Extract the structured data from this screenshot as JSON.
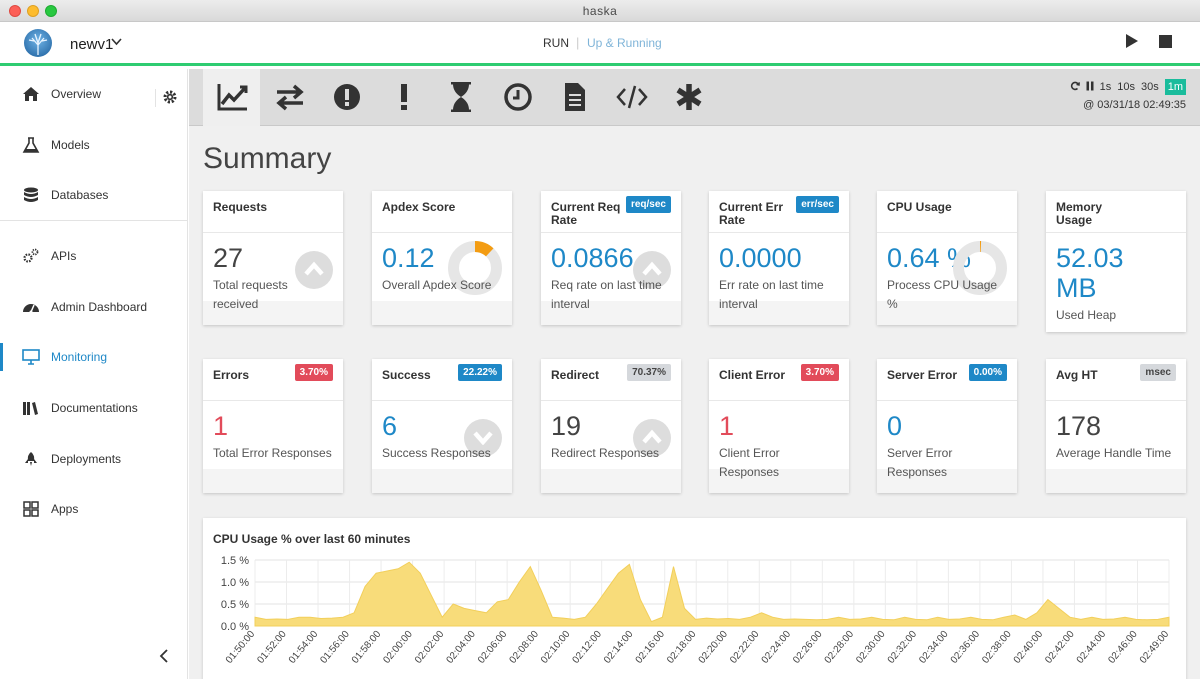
{
  "window": {
    "title": "haska"
  },
  "header": {
    "project": "newv1",
    "run_label": "RUN",
    "status": "Up & Running"
  },
  "sidebar": {
    "items": [
      {
        "label": "Overview",
        "icon": "home-icon"
      },
      {
        "label": "Models",
        "icon": "flask-icon"
      },
      {
        "label": "Databases",
        "icon": "database-icon"
      },
      {
        "label": "APIs",
        "icon": "cogs-icon"
      },
      {
        "label": "Admin Dashboard",
        "icon": "dashboard-icon"
      },
      {
        "label": "Monitoring",
        "icon": "monitor-icon",
        "active": true
      },
      {
        "label": "Documentations",
        "icon": "books-icon"
      },
      {
        "label": "Deployments",
        "icon": "rocket-icon"
      },
      {
        "label": "Apps",
        "icon": "grid-icon"
      }
    ]
  },
  "toolbar": {
    "tools": [
      "line-chart-icon",
      "exchange-icon",
      "exclamation-circle-icon",
      "exclamation-icon",
      "hourglass-icon",
      "clock-icon",
      "file-icon",
      "code-icon",
      "asterisk-icon"
    ],
    "refresh_options": [
      "1s",
      "10s",
      "30s",
      "1m"
    ],
    "active_refresh": "1m",
    "timestamp": "@ 03/31/18 02:49:35"
  },
  "summary": {
    "title": "Summary",
    "cards_row1": [
      {
        "title": "Requests",
        "value": "27",
        "desc": "Total requests received",
        "decor": "up"
      },
      {
        "title": "Apdex Score",
        "value": "0.12",
        "desc": "Overall Apdex Score",
        "decor": "ring",
        "fill": 0.12,
        "value_color": "blue"
      },
      {
        "title": "Current Req Rate",
        "badge": "req/sec",
        "badge_color": "blue",
        "value": "0.0866",
        "desc": "Req rate on last time interval",
        "decor": "up",
        "value_color": "blue"
      },
      {
        "title": "Current Err Rate",
        "badge": "err/sec",
        "badge_color": "blue",
        "value": "0.0000",
        "desc": "Err rate on last time interval",
        "value_color": "blue"
      },
      {
        "title": "CPU Usage",
        "value": "0.64 %",
        "desc": "Process CPU Usage %",
        "decor": "ring",
        "fill": 0.0064,
        "value_color": "blue"
      },
      {
        "title": "Memory Usage",
        "value": "52.03 MB",
        "desc": "Used Heap",
        "value_color": "blue"
      }
    ],
    "cards_row2": [
      {
        "title": "Errors",
        "badge": "3.70%",
        "badge_color": "red",
        "value": "1",
        "desc": "Total Error Responses",
        "value_color": "red"
      },
      {
        "title": "Success",
        "badge": "22.22%",
        "badge_color": "blue",
        "value": "6",
        "desc": "Success Responses",
        "decor": "down",
        "value_color": "blue"
      },
      {
        "title": "Redirect",
        "badge": "70.37%",
        "badge_color": "gray",
        "value": "19",
        "desc": "Redirect Responses",
        "decor": "up"
      },
      {
        "title": "Client Error",
        "badge": "3.70%",
        "badge_color": "red",
        "value": "1",
        "desc": "Client Error Responses",
        "value_color": "red"
      },
      {
        "title": "Server Error",
        "badge": "0.00%",
        "badge_color": "blue",
        "value": "0",
        "desc": "Server Error Responses",
        "value_color": "blue"
      },
      {
        "title": "Avg HT",
        "badge": "msec",
        "badge_color": "gray",
        "value": "178",
        "desc": "Average Handle Time"
      }
    ]
  },
  "chart_data": {
    "type": "area",
    "title": "CPU Usage % over last 60 minutes",
    "ylim": [
      0,
      1.5
    ],
    "yticks": [
      "1.5 %",
      "1.0 %",
      "0.5 %",
      "0.0 %"
    ],
    "color": "#f8dc7a",
    "x": [
      "01:50:00",
      "01:52:00",
      "01:54:00",
      "01:56:00",
      "01:58:00",
      "02:00:00",
      "02:02:00",
      "02:04:00",
      "02:06:00",
      "02:08:00",
      "02:10:00",
      "02:12:00",
      "02:14:00",
      "02:16:00",
      "02:18:00",
      "02:20:00",
      "02:22:00",
      "02:24:00",
      "02:26:00",
      "02:28:00",
      "02:30:00",
      "02:32:00",
      "02:34:00",
      "02:36:00",
      "02:38:00",
      "02:40:00",
      "02:42:00",
      "02:44:00",
      "02:46:00",
      "02:49:00"
    ],
    "values": [
      0.2,
      0.15,
      0.16,
      0.15,
      0.2,
      0.2,
      0.17,
      0.18,
      0.2,
      0.3,
      0.9,
      1.2,
      1.25,
      1.3,
      1.45,
      1.2,
      0.7,
      0.2,
      0.5,
      0.4,
      0.35,
      0.3,
      0.55,
      0.6,
      1.0,
      1.35,
      0.8,
      0.2,
      0.18,
      0.15,
      0.2,
      0.5,
      0.85,
      1.2,
      1.4,
      0.6,
      0.1,
      0.2,
      1.35,
      0.4,
      0.15,
      0.18,
      0.16,
      0.17,
      0.15,
      0.2,
      0.3,
      0.2,
      0.15,
      0.16,
      0.15,
      0.14,
      0.15,
      0.2,
      0.15,
      0.16,
      0.2,
      0.15,
      0.14,
      0.2,
      0.15,
      0.14,
      0.2,
      0.15,
      0.16,
      0.2,
      0.15,
      0.14,
      0.2,
      0.25,
      0.15,
      0.3,
      0.6,
      0.4,
      0.2,
      0.15,
      0.2,
      0.15,
      0.16,
      0.2,
      0.15,
      0.14,
      0.15,
      0.2
    ]
  }
}
